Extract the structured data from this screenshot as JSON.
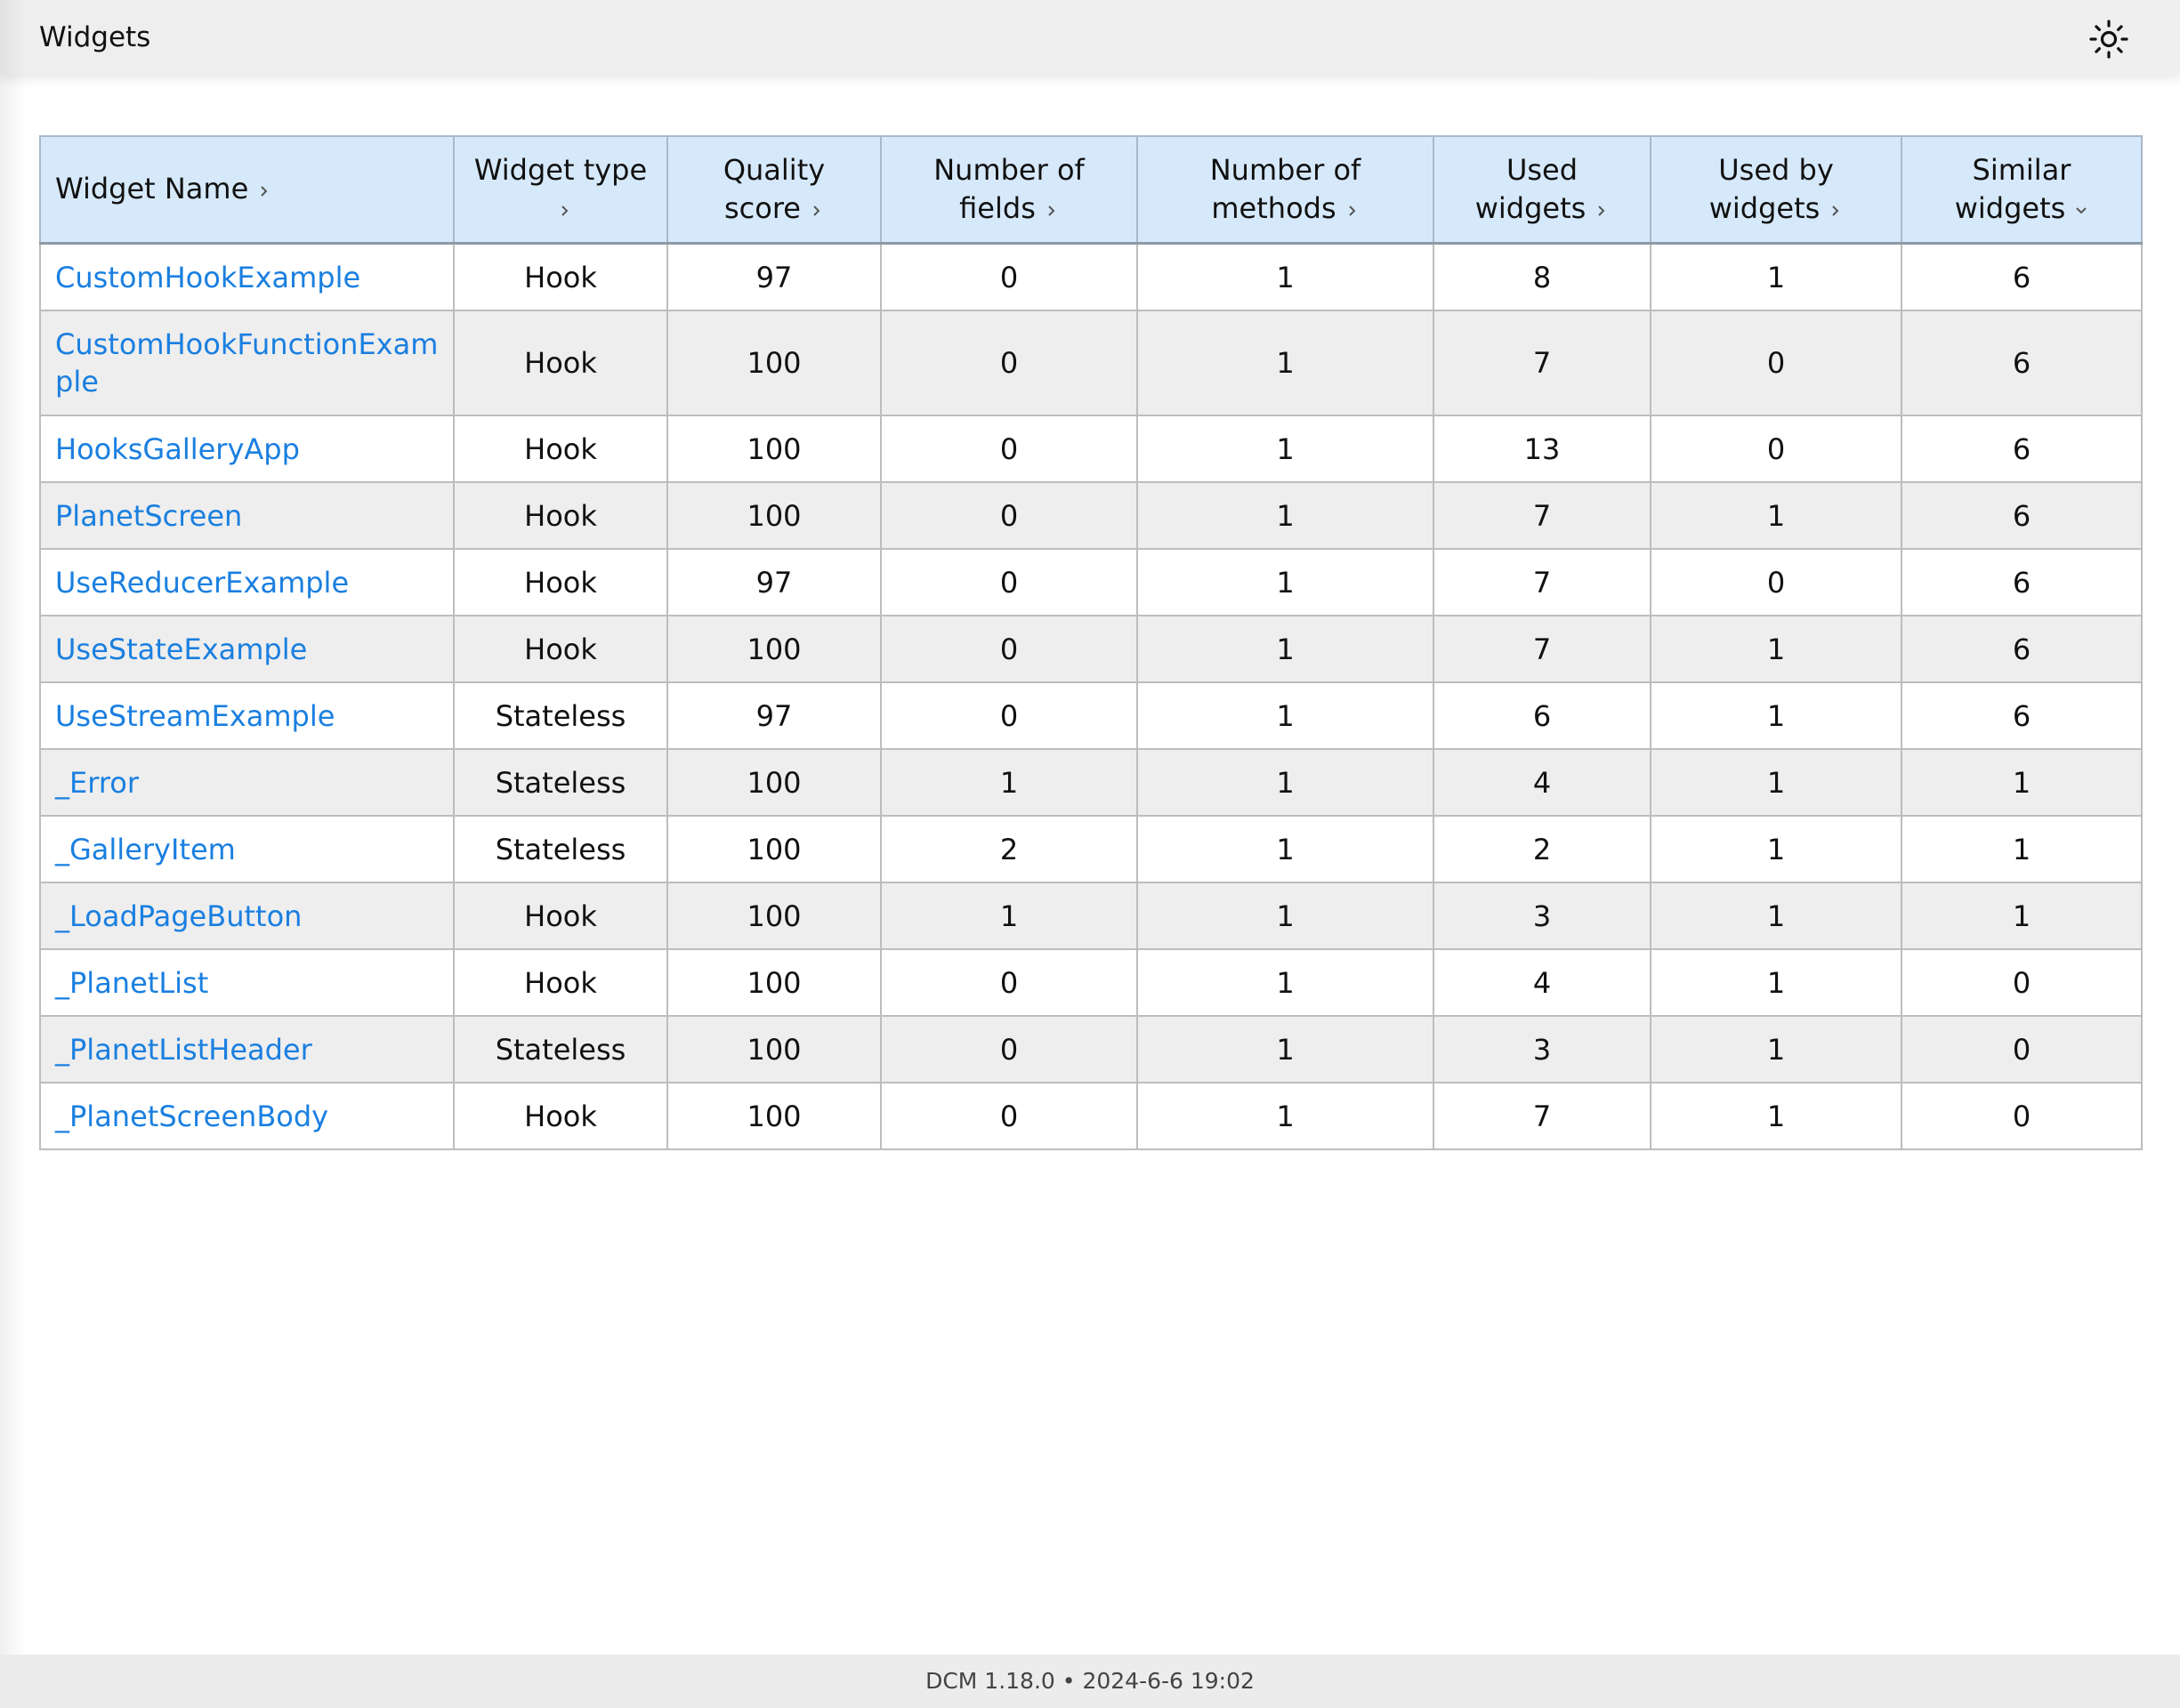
{
  "header": {
    "title": "Widgets",
    "theme_icon": "sun-icon"
  },
  "table": {
    "columns": [
      {
        "label": "Widget Name",
        "sort_icon": "chevron-right-icon"
      },
      {
        "label": "Widget type",
        "sort_icon": "chevron-right-icon"
      },
      {
        "label": "Quality score",
        "sort_icon": "chevron-right-icon"
      },
      {
        "label": "Number of fields",
        "sort_icon": "chevron-right-icon"
      },
      {
        "label": "Number of methods",
        "sort_icon": "chevron-right-icon"
      },
      {
        "label": "Used widgets",
        "sort_icon": "chevron-right-icon"
      },
      {
        "label": "Used by widgets",
        "sort_icon": "chevron-right-icon"
      },
      {
        "label": "Similar widgets",
        "sort_icon": "chevron-down-icon"
      }
    ],
    "rows": [
      {
        "name": "CustomHookExample",
        "type": "Hook",
        "quality": "97",
        "fields": "0",
        "methods": "1",
        "used": "8",
        "used_by": "1",
        "similar": "6"
      },
      {
        "name": "CustomHookFunctionExample",
        "type": "Hook",
        "quality": "100",
        "fields": "0",
        "methods": "1",
        "used": "7",
        "used_by": "0",
        "similar": "6"
      },
      {
        "name": "HooksGalleryApp",
        "type": "Hook",
        "quality": "100",
        "fields": "0",
        "methods": "1",
        "used": "13",
        "used_by": "0",
        "similar": "6"
      },
      {
        "name": "PlanetScreen",
        "type": "Hook",
        "quality": "100",
        "fields": "0",
        "methods": "1",
        "used": "7",
        "used_by": "1",
        "similar": "6"
      },
      {
        "name": "UseReducerExample",
        "type": "Hook",
        "quality": "97",
        "fields": "0",
        "methods": "1",
        "used": "7",
        "used_by": "0",
        "similar": "6"
      },
      {
        "name": "UseStateExample",
        "type": "Hook",
        "quality": "100",
        "fields": "0",
        "methods": "1",
        "used": "7",
        "used_by": "1",
        "similar": "6"
      },
      {
        "name": "UseStreamExample",
        "type": "Stateless",
        "quality": "97",
        "fields": "0",
        "methods": "1",
        "used": "6",
        "used_by": "1",
        "similar": "6"
      },
      {
        "name": "_Error",
        "type": "Stateless",
        "quality": "100",
        "fields": "1",
        "methods": "1",
        "used": "4",
        "used_by": "1",
        "similar": "1"
      },
      {
        "name": "_GalleryItem",
        "type": "Stateless",
        "quality": "100",
        "fields": "2",
        "methods": "1",
        "used": "2",
        "used_by": "1",
        "similar": "1"
      },
      {
        "name": "_LoadPageButton",
        "type": "Hook",
        "quality": "100",
        "fields": "1",
        "methods": "1",
        "used": "3",
        "used_by": "1",
        "similar": "1"
      },
      {
        "name": "_PlanetList",
        "type": "Hook",
        "quality": "100",
        "fields": "0",
        "methods": "1",
        "used": "4",
        "used_by": "1",
        "similar": "0"
      },
      {
        "name": "_PlanetListHeader",
        "type": "Stateless",
        "quality": "100",
        "fields": "0",
        "methods": "1",
        "used": "3",
        "used_by": "1",
        "similar": "0"
      },
      {
        "name": "_PlanetScreenBody",
        "type": "Hook",
        "quality": "100",
        "fields": "0",
        "methods": "1",
        "used": "7",
        "used_by": "1",
        "similar": "0"
      }
    ]
  },
  "footer": {
    "text": "DCM 1.18.0 • 2024-6-6 19:02"
  },
  "colors": {
    "link": "#1a7fe0",
    "header_row_bg": "#d6e9fb",
    "stripe_bg": "#eeeeee"
  }
}
